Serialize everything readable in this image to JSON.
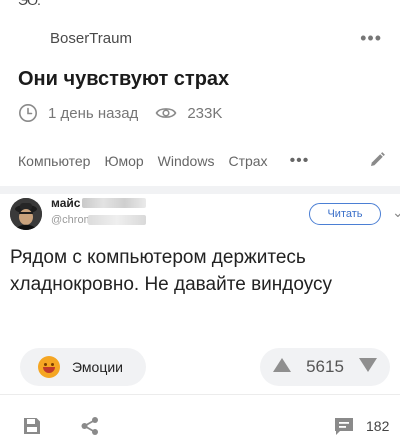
{
  "header": {
    "clipped_text": "ЭО.",
    "author": "BoserTraum",
    "more_icon": "more-horizontal-icon"
  },
  "post": {
    "title": "Они чувствуют страх",
    "time": "1 день назад",
    "views": "233K"
  },
  "tags": {
    "items": [
      "Компьютер",
      "Юмор",
      "Windows",
      "Страх"
    ],
    "more": "•••",
    "edit_icon": "pencil-icon"
  },
  "comment": {
    "author_visible": "майс",
    "sub_visible": "@chrom",
    "read_label": "Читать",
    "text": "Рядом с компьютером держитесь хладнокровно. Не давайте виндоусу"
  },
  "actions": {
    "emotions_label": "Эмоции",
    "vote_count": "5615"
  },
  "bottom": {
    "comments_count": "182"
  },
  "colors": {
    "accent": "#4b7fd4",
    "muted": "#777777",
    "chip_bg": "#f1f2f4"
  }
}
